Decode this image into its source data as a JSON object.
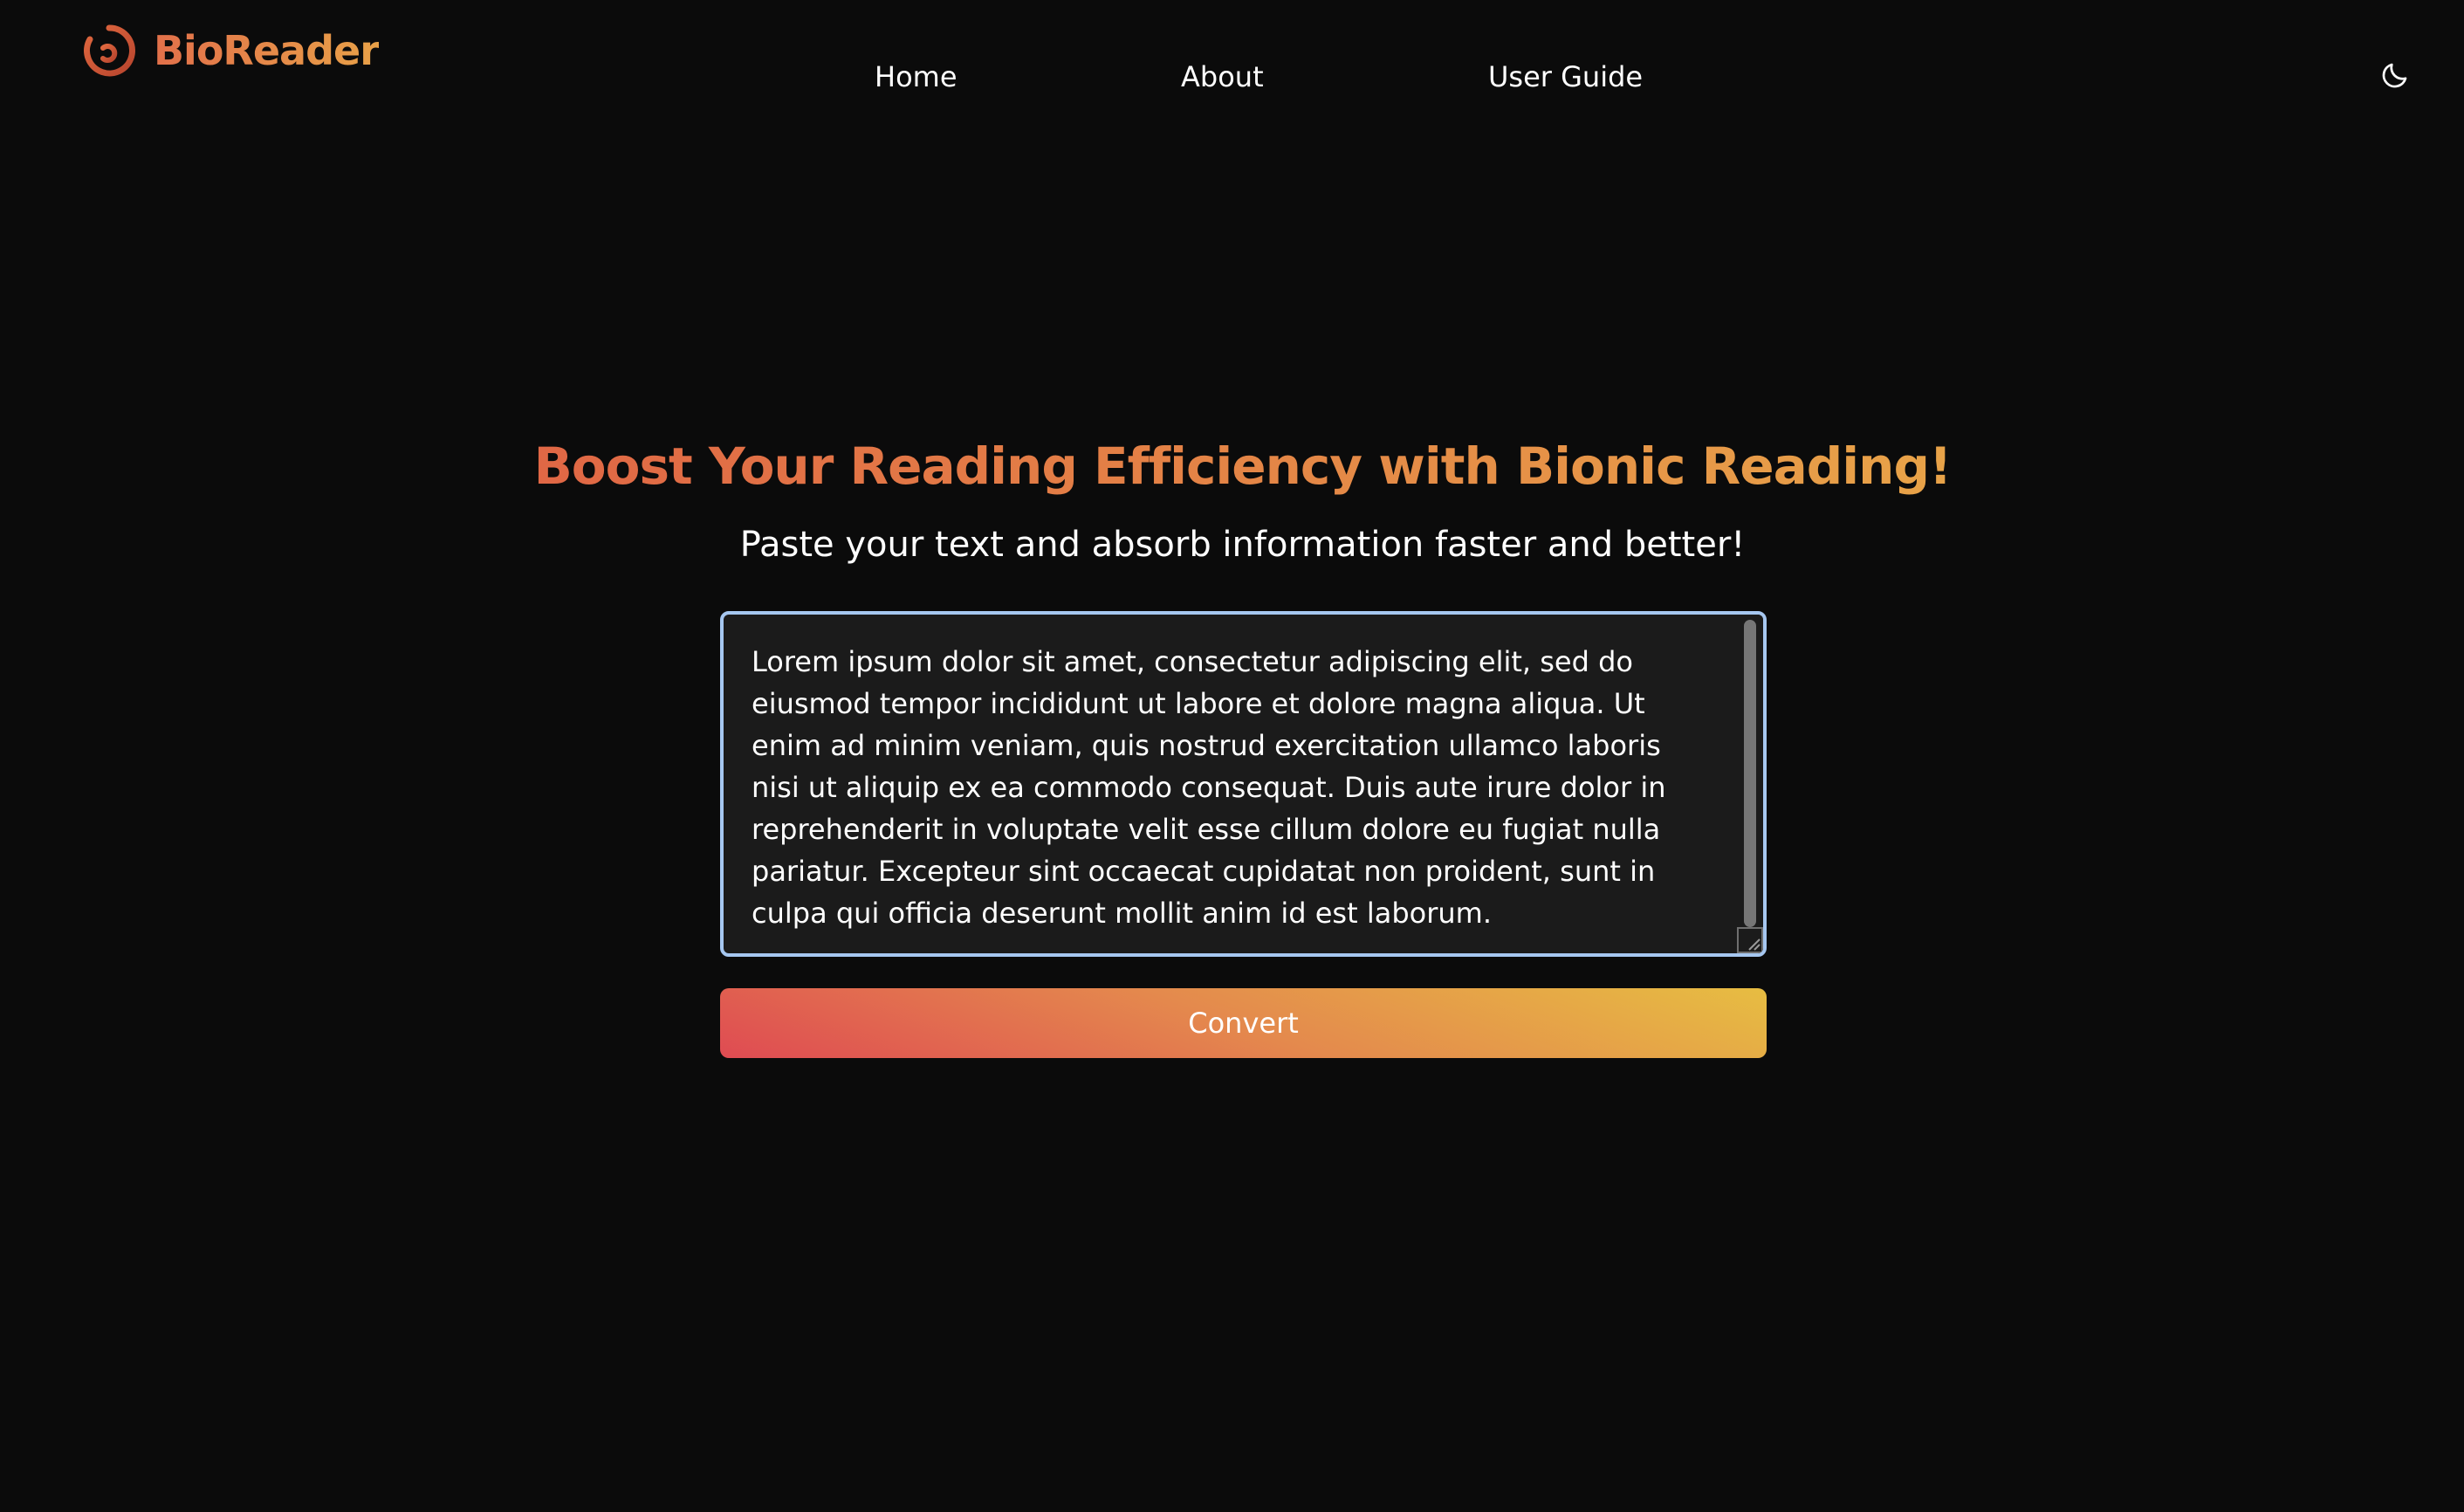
{
  "header": {
    "brand": "BioReader",
    "logo_icon": "bioreader-logo-icon",
    "nav": [
      {
        "label": "Home"
      },
      {
        "label": "About"
      },
      {
        "label": "User Guide"
      }
    ],
    "theme_toggle_icon": "moon-icon"
  },
  "hero": {
    "title": "Boost Your Reading Efficiency with Bionic Reading!",
    "subtitle": "Paste your text and absorb information faster and better!"
  },
  "editor": {
    "value": "Lorem ipsum dolor sit amet, consectetur adipiscing elit, sed do eiusmod tempor incididunt ut labore et dolore magna aliqua. Ut enim ad minim veniam, quis nostrud exercitation ullamco laboris nisi ut aliquip ex ea commodo consequat. Duis aute irure dolor in reprehenderit in voluptate velit esse cillum dolore eu fugiat nulla pariatur. Excepteur sint occaecat cupidatat non proident, sunt in culpa qui officia deserunt mollit anim id est laborum.",
    "focused": true
  },
  "actions": {
    "convert_label": "Convert"
  },
  "colors": {
    "background": "#0b0b0b",
    "accent_start": "#e06745",
    "accent_end": "#e8a348",
    "button_gradient": [
      "#df4b52",
      "#e48a4d",
      "#e7bd42"
    ],
    "focus_border": "#a6c7f0",
    "editor_background": "#1b1b1b"
  }
}
